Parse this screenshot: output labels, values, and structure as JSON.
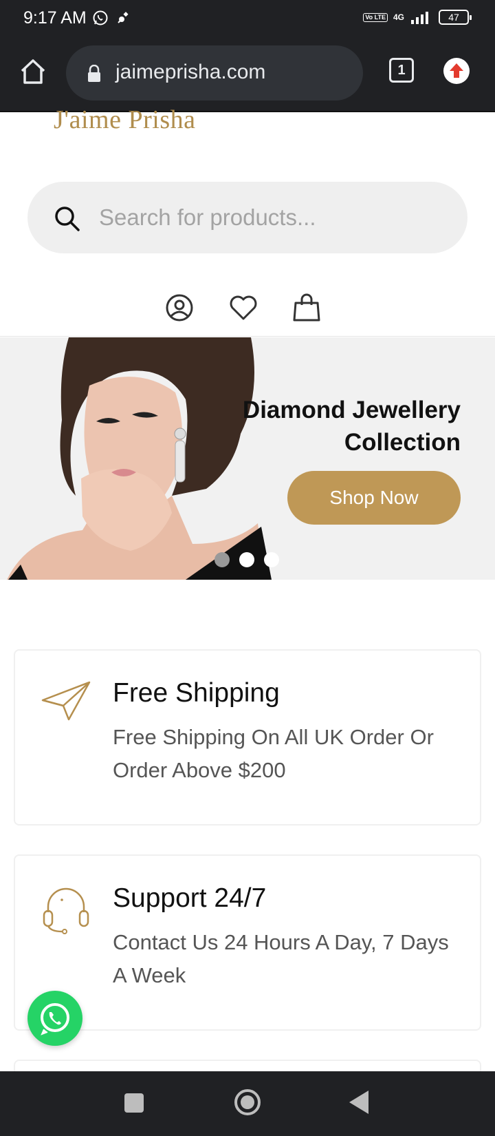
{
  "status_bar": {
    "time": "9:17 AM",
    "network": "4G",
    "volte": "Vo LTE",
    "battery": "47"
  },
  "browser": {
    "url": "jaimeprisha.com",
    "tab_count": "1"
  },
  "site": {
    "logo": "J'aime Prisha",
    "search_placeholder": "Search for products..."
  },
  "hero": {
    "title": "Diamond Jewellery Collection",
    "cta": "Shop Now",
    "active_slide": 1,
    "slide_count": 3
  },
  "features": [
    {
      "title": "Free Shipping",
      "description": "Free Shipping On All UK Order Or Order Above $200",
      "icon": "paper-plane-icon"
    },
    {
      "title": "Support 24/7",
      "description": "Contact Us 24 Hours A Day, 7 Days A Week",
      "icon": "headset-icon"
    }
  ],
  "colors": {
    "accent": "#bf9856",
    "logo": "#b08d4d",
    "whatsapp": "#25d366",
    "chrome_bg": "#202124"
  }
}
